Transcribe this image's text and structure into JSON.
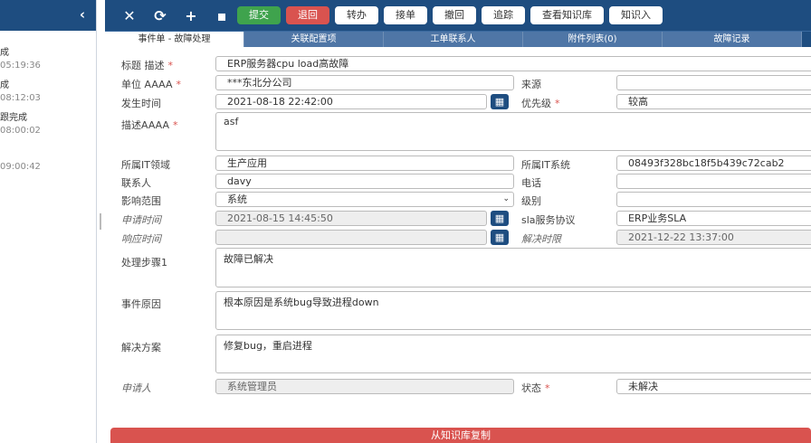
{
  "sidebar": {
    "items": [
      {
        "title": "成",
        "time": "05:19:36"
      },
      {
        "title": "成",
        "time": "08:12:03"
      },
      {
        "title": "跟完成",
        "time": "08:00:02"
      },
      {
        "title": "",
        "time": "09:00:42"
      }
    ]
  },
  "toolbar": {
    "icons": [
      "close-icon",
      "refresh-icon",
      "plus-icon",
      "save-icon"
    ],
    "submit": "提交",
    "return": "退回",
    "transfer": "转办",
    "accept": "接单",
    "revoke": "撤回",
    "track": "追踪",
    "view_kb": "查看知识库",
    "kb": "知识入"
  },
  "tabs": [
    "事件单  - 故障处理",
    "关联配置项",
    "工单联系人",
    "附件列表(0)",
    "故障记录"
  ],
  "form": {
    "title_label": "标题 描述",
    "title_value": "ERP服务器cpu load高故障",
    "unit_label": "单位 AAAA",
    "unit_value": "***东北分公司",
    "source_label": "来源",
    "source_value": "",
    "occur_label": "发生时间",
    "occur_value": "2021-08-18 22:42:00",
    "priority_label": "优先级",
    "priority_value": "较高",
    "desc_label": "描述AAAA",
    "desc_value": "asf",
    "domain_label": "所属IT领域",
    "domain_value": "生产应用",
    "system_label": "所属IT系统",
    "system_value": "08493f328bc18f5b439c72cab2",
    "contact_label": "联系人",
    "contact_value": "davy",
    "phone_label": "电话",
    "phone_value": "",
    "scope_label": "影响范围",
    "scope_value": "系统",
    "level_label": "级别",
    "level_value": "",
    "apply_label": "申请时间",
    "apply_value": "2021-08-15 14:45:50",
    "sla_label": "sla服务协议",
    "sla_value": "ERP业务SLA",
    "response_label": "响应时间",
    "response_value": "",
    "resolve_label": "解决时限",
    "resolve_value": "2021-12-22 13:37:00",
    "step_label": "处理步骤1",
    "step_value": "故障已解决",
    "cause_label": "事件原因",
    "cause_value": "根本原因是系统bug导致进程down",
    "solution_label": "解决方案",
    "solution_value": "修复bug，重启进程",
    "applicant_label": "申请人",
    "applicant_value": "系统管理员",
    "status_label": "状态",
    "status_value": "未解决"
  },
  "footer": {
    "copy_kb": "从知识库复制"
  }
}
